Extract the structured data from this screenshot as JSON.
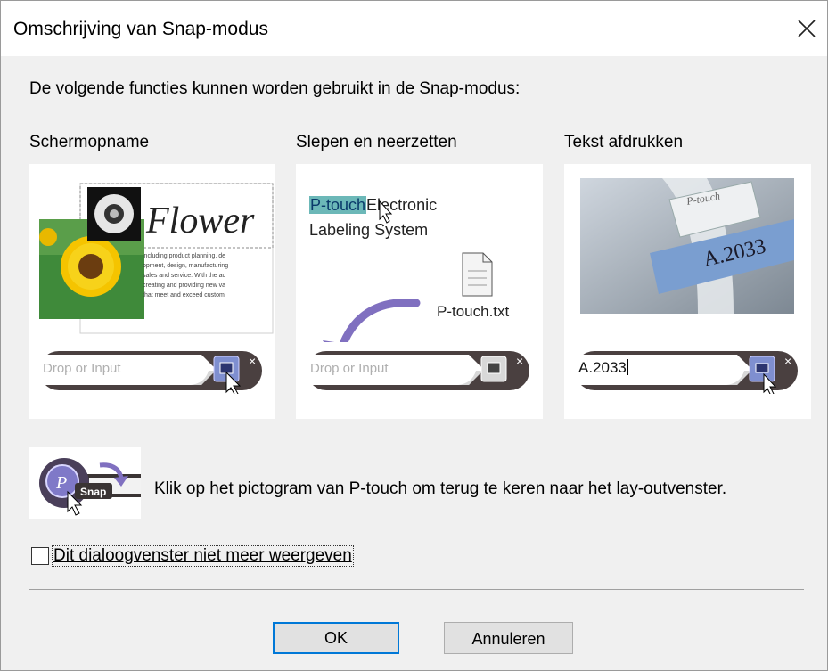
{
  "dialog": {
    "title": "Omschrijving van Snap-modus",
    "description": "De volgende functies kunnen worden gebruikt in de Snap-modus:"
  },
  "sections": [
    {
      "title": "Schermopname"
    },
    {
      "title": "Slepen en neerzetten"
    },
    {
      "title": "Tekst afdrukken"
    }
  ],
  "panel1": {
    "heading": "Flower",
    "body_lines": [
      "including product planning, de",
      "opment, design, manufacturing",
      "sales and service. With the ac",
      "creating and providing new va",
      "that meet and exceed custom"
    ],
    "bar_placeholder": "Drop or Input"
  },
  "panel2": {
    "line1_highlight": "P-touch",
    "line1_rest": "Electronic",
    "line2": "Labeling System",
    "file_name": "P-touch.txt",
    "bar_placeholder": "Drop or Input"
  },
  "panel3": {
    "label_text": "A.2033",
    "tape_brand": "P-touch",
    "bar_value": "A.2033"
  },
  "snap": {
    "badge": "Snap",
    "instruction": "Klik op het pictogram van P-touch om terug te keren naar het lay-outvenster."
  },
  "checkbox": {
    "label": "Dit dialoogvenster niet meer weergeven",
    "checked": false
  },
  "buttons": {
    "ok": "OK",
    "cancel": "Annuleren"
  },
  "colors": {
    "accent": "#0078d7",
    "highlight": "#6cb8b8",
    "tape_blue": "#7a9ed0",
    "drag_arrow": "#8070c0"
  }
}
